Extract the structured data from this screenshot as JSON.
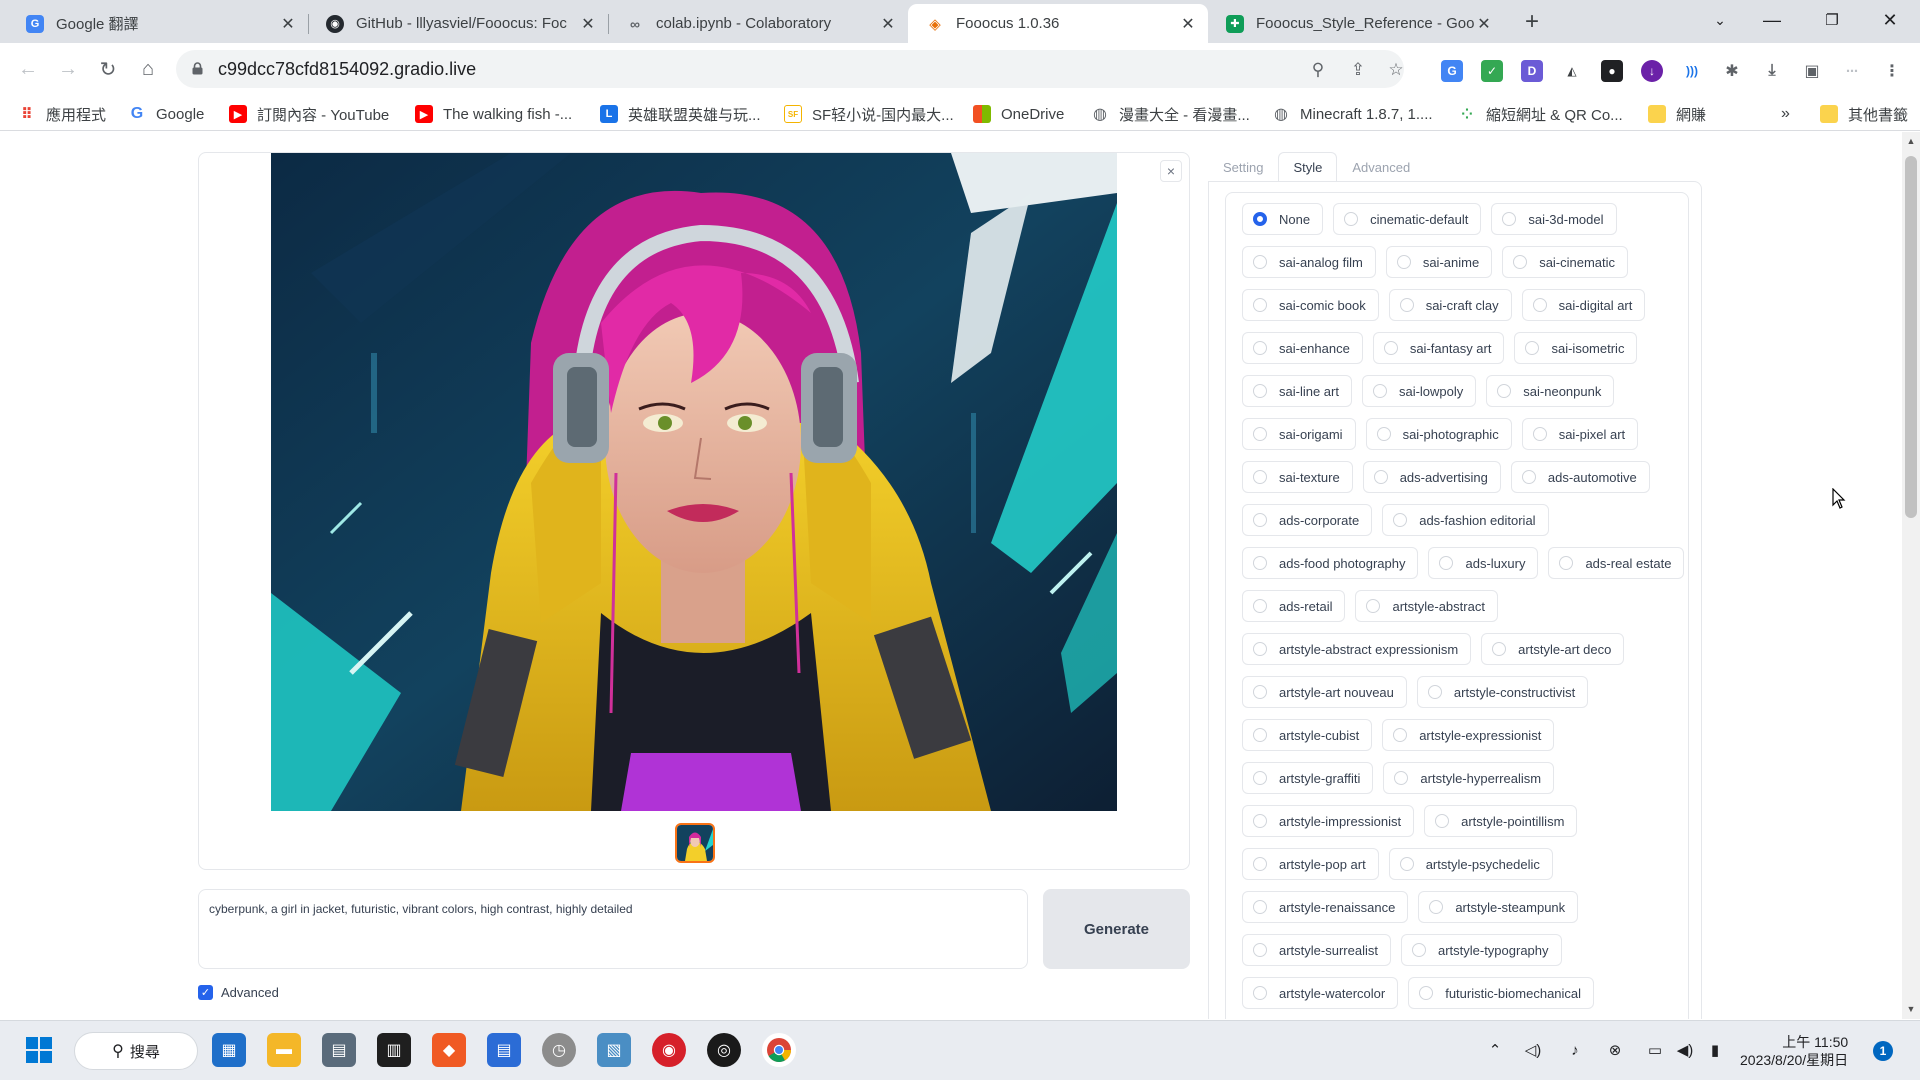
{
  "browser": {
    "tabs": [
      {
        "title": "Google 翻譯",
        "icon": "google-translate-icon"
      },
      {
        "title": "GitHub - lllyasviel/Fooocus: Foc",
        "icon": "github-icon"
      },
      {
        "title": "colab.ipynb - Colaboratory",
        "icon": "colab-icon"
      },
      {
        "title": "Fooocus 1.0.36",
        "icon": "fooocus-icon",
        "active": true
      },
      {
        "title": "Fooocus_Style_Reference - Goo",
        "icon": "google-sheets-icon"
      }
    ],
    "url": "c99dcc78cfd8154092.gradio.live",
    "bookmarks": [
      {
        "label": "應用程式",
        "icon": "apps-grid-icon"
      },
      {
        "label": "Google",
        "icon": "google-icon"
      },
      {
        "label": "訂閱內容 - YouTube",
        "icon": "youtube-icon"
      },
      {
        "label": "The walking fish -...",
        "icon": "youtube-icon"
      },
      {
        "label": "英雄联盟英雄与玩...",
        "icon": "bookmark-l-icon"
      },
      {
        "label": "SF轻小说-国内最大...",
        "icon": "sf-icon"
      },
      {
        "label": "OneDrive",
        "icon": "microsoft-icon"
      },
      {
        "label": "漫畫大全 - 看漫畫...",
        "icon": "globe-icon"
      },
      {
        "label": "Minecraft 1.8.7, 1....",
        "icon": "globe-icon"
      },
      {
        "label": "縮短網址 & QR Co...",
        "icon": "dots-icon"
      },
      {
        "label": "網賺",
        "icon": "folder-icon"
      }
    ],
    "bookmarks_overflow": "»",
    "other_bookmarks": "其他書籤"
  },
  "app": {
    "gallery_close": "×",
    "prompt": "cyberpunk, a girl in jacket, futuristic, vibrant colors, high contrast, highly detailed",
    "generate_label": "Generate",
    "advanced_label": "Advanced",
    "advanced_checked": true,
    "panel_tabs": [
      "Setting",
      "Style",
      "Advanced"
    ],
    "active_panel_tab": "Style",
    "selected_style": "None",
    "style_rows": [
      [
        "None",
        "cinematic-default",
        "sai-3d-model"
      ],
      [
        "sai-analog film",
        "sai-anime",
        "sai-cinematic"
      ],
      [
        "sai-comic book",
        "sai-craft clay",
        "sai-digital art"
      ],
      [
        "sai-enhance",
        "sai-fantasy art",
        "sai-isometric"
      ],
      [
        "sai-line art",
        "sai-lowpoly",
        "sai-neonpunk"
      ],
      [
        "sai-origami",
        "sai-photographic",
        "sai-pixel art"
      ],
      [
        "sai-texture",
        "ads-advertising",
        "ads-automotive"
      ],
      [
        "ads-corporate",
        "ads-fashion editorial"
      ],
      [
        "ads-food photography",
        "ads-luxury",
        "ads-real estate"
      ],
      [
        "ads-retail",
        "artstyle-abstract"
      ],
      [
        "artstyle-abstract expressionism",
        "artstyle-art deco"
      ],
      [
        "artstyle-art nouveau",
        "artstyle-constructivist"
      ],
      [
        "artstyle-cubist",
        "artstyle-expressionist"
      ],
      [
        "artstyle-graffiti",
        "artstyle-hyperrealism"
      ],
      [
        "artstyle-impressionist",
        "artstyle-pointillism"
      ],
      [
        "artstyle-pop art",
        "artstyle-psychedelic"
      ],
      [
        "artstyle-renaissance",
        "artstyle-steampunk"
      ],
      [
        "artstyle-surrealist",
        "artstyle-typography"
      ],
      [
        "artstyle-watercolor",
        "futuristic-biomechanical"
      ]
    ]
  },
  "taskbar": {
    "search_label": "搜尋",
    "time": "上午 11:50",
    "date": "2023/8/20/星期日",
    "notification_count": "1"
  }
}
